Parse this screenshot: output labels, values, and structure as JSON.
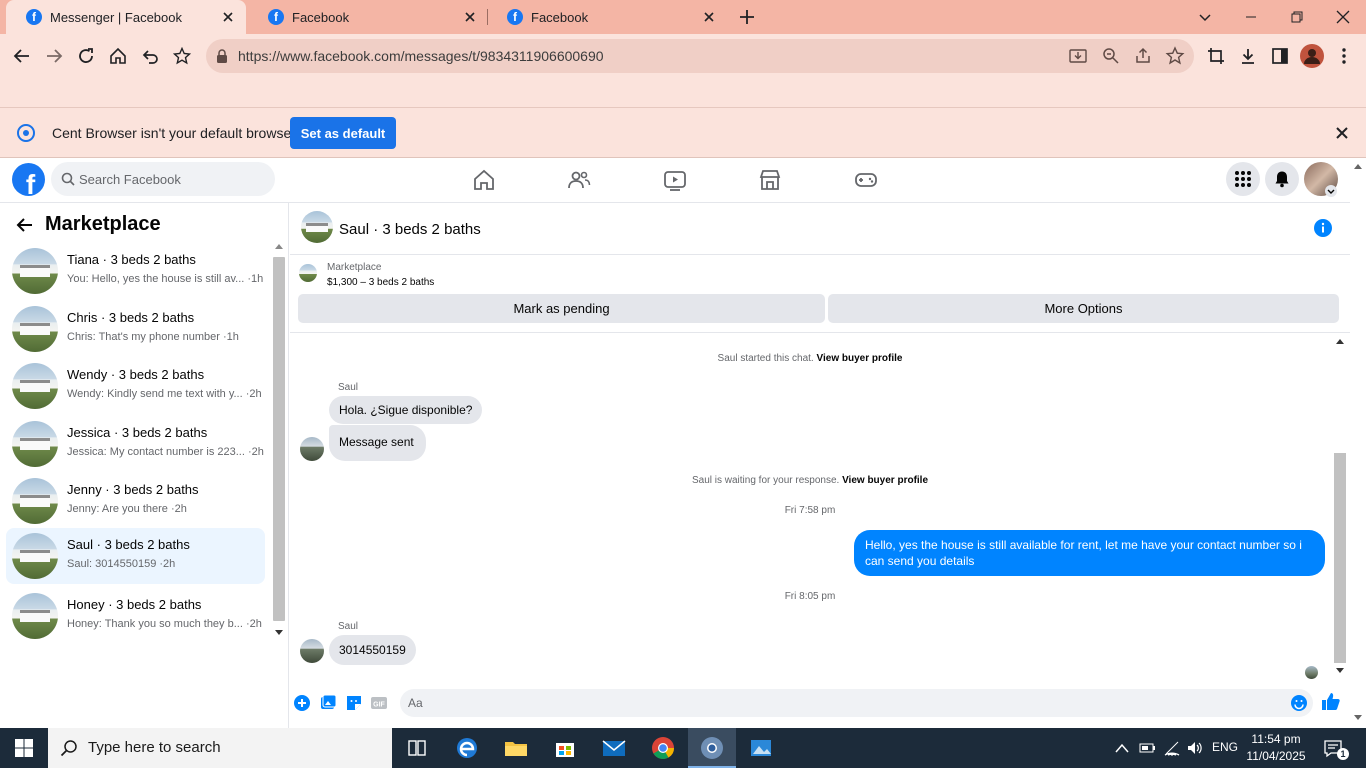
{
  "browser": {
    "tabs": [
      {
        "label": "Messenger | Facebook"
      },
      {
        "label": "Facebook"
      },
      {
        "label": "Facebook"
      }
    ],
    "url": "https://www.facebook.com/messages/t/9834311906600690",
    "infobar": {
      "message": "Cent Browser isn't your default browser",
      "button": "Set as default"
    }
  },
  "fb": {
    "search_placeholder": "Search Facebook"
  },
  "sidebar": {
    "title": "Marketplace",
    "conversations": [
      {
        "name": "Tiana · 3 beds 2 baths",
        "snippet": "You: Hello, yes the house is still av... ·1h"
      },
      {
        "name": "Chris · 3 beds 2 baths",
        "snippet": "Chris: That's my phone number ·1h"
      },
      {
        "name": "Wendy · 3 beds 2 baths",
        "snippet": "Wendy: Kindly send me text with y... ·2h"
      },
      {
        "name": "Jessica · 3 beds 2 baths",
        "snippet": "Jessica: My contact number is 223... ·2h"
      },
      {
        "name": "Jenny · 3 beds 2 baths",
        "snippet": "Jenny: Are you there ·2h"
      },
      {
        "name": "Saul · 3 beds 2 baths",
        "snippet": "Saul: 3014550159 ·2h"
      },
      {
        "name": "Honey · 3 beds 2 baths",
        "snippet": "Honey: Thank you so much they b... ·2h"
      }
    ]
  },
  "chat": {
    "title": "Saul · 3 beds 2 baths",
    "listing": {
      "source": "Marketplace",
      "price": "$1,300 – 3 beds 2 baths",
      "mark_pending": "Mark as pending",
      "more_options": "More Options"
    },
    "messages": {
      "started": "Saul started this chat.",
      "view_profile": "View buyer profile",
      "sender": "Saul",
      "m1": "Hola. ¿Sigue disponible?",
      "m2": "Message sent",
      "waiting": "Saul is waiting for your response.",
      "time1": "Fri 7:58 pm",
      "mine": "Hello, yes the house is still available for rent, let me have your contact number so i can send you details",
      "time2": "Fri 8:05 pm",
      "m3": "3014550159"
    },
    "composer_placeholder": "Aa"
  },
  "taskbar": {
    "search": "Type here to search",
    "lang": "ENG",
    "time": "11:54 pm",
    "date": "11/04/2025",
    "notifications": "1"
  },
  "colors": {
    "fb_blue": "#1877f2",
    "message_blue": "#0084ff",
    "tabstrip": "#f4b5a5",
    "toolbar": "#fbe3dc"
  }
}
